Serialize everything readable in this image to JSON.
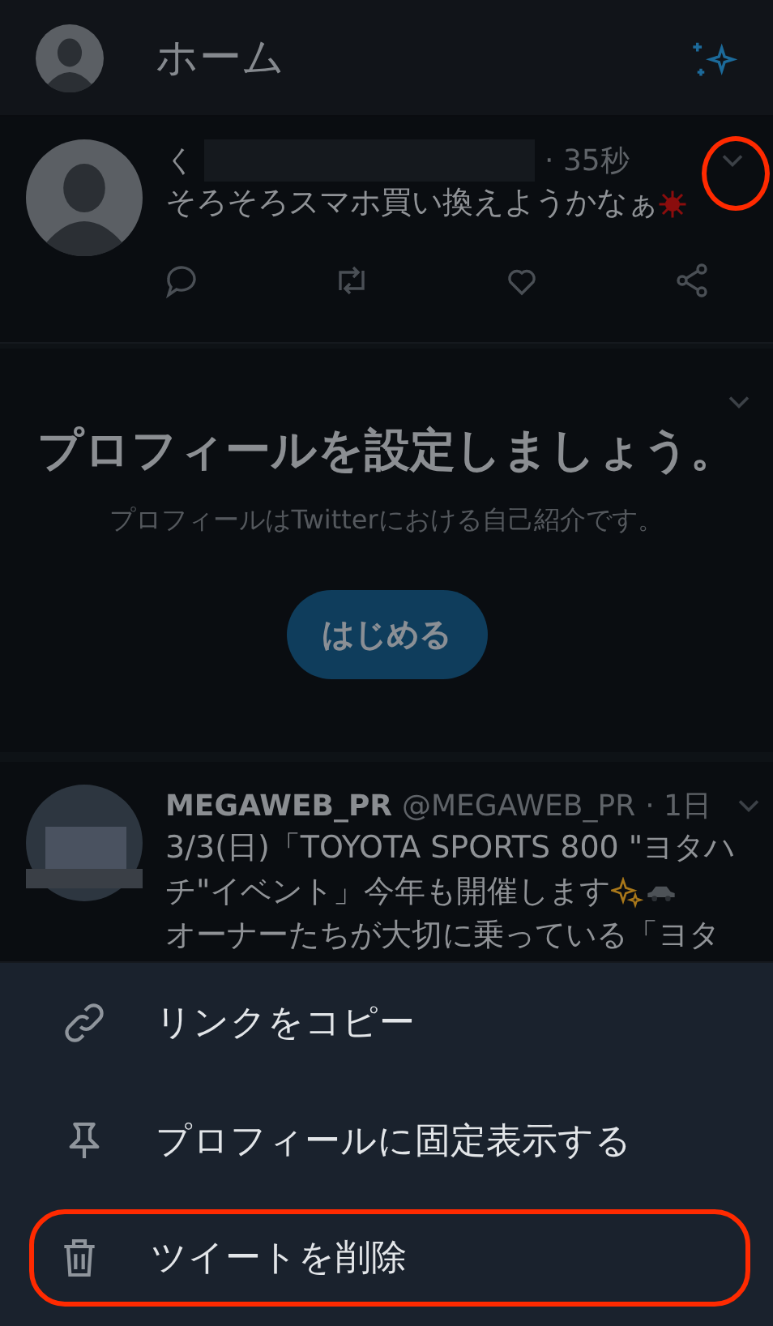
{
  "header": {
    "title": "ホーム"
  },
  "tweets": [
    {
      "name": "く",
      "name_redacted": true,
      "time": "· 35秒",
      "menu_highlighted": true,
      "lines": [
        [
          {
            "kind": "text",
            "value": "そろそろスマホ買い換えようかなぁ"
          },
          {
            "kind": "sun"
          }
        ]
      ]
    },
    {
      "name": "MEGAWEB_PR",
      "name_redacted": false,
      "handle": "@MEGAWEB_PR",
      "time": "· 1日",
      "menu_highlighted": false,
      "lines": [
        [
          {
            "kind": "text",
            "value": "3/3(日)「TOYOTA SPORTS 800 \"ヨタハ"
          }
        ],
        [
          {
            "kind": "text",
            "value": "チ\"イベント」今年も開催します"
          },
          {
            "kind": "sparkles"
          },
          {
            "kind": "car"
          }
        ],
        [
          {
            "kind": "text",
            "value": "オーナーたちが大切に乗っている「ヨタ"
          }
        ]
      ]
    }
  ],
  "profile_prompt": {
    "title": "プロフィールを設定しましょう。",
    "subtitle": "プロフィールはTwitterにおける自己紹介です。",
    "button": "はじめる"
  },
  "sheet": {
    "items": [
      {
        "label": "リンクをコピー",
        "highlighted": false
      },
      {
        "label": "プロフィールに固定表示する",
        "highlighted": false
      },
      {
        "label": "ツイートを削除",
        "highlighted": true
      }
    ]
  }
}
